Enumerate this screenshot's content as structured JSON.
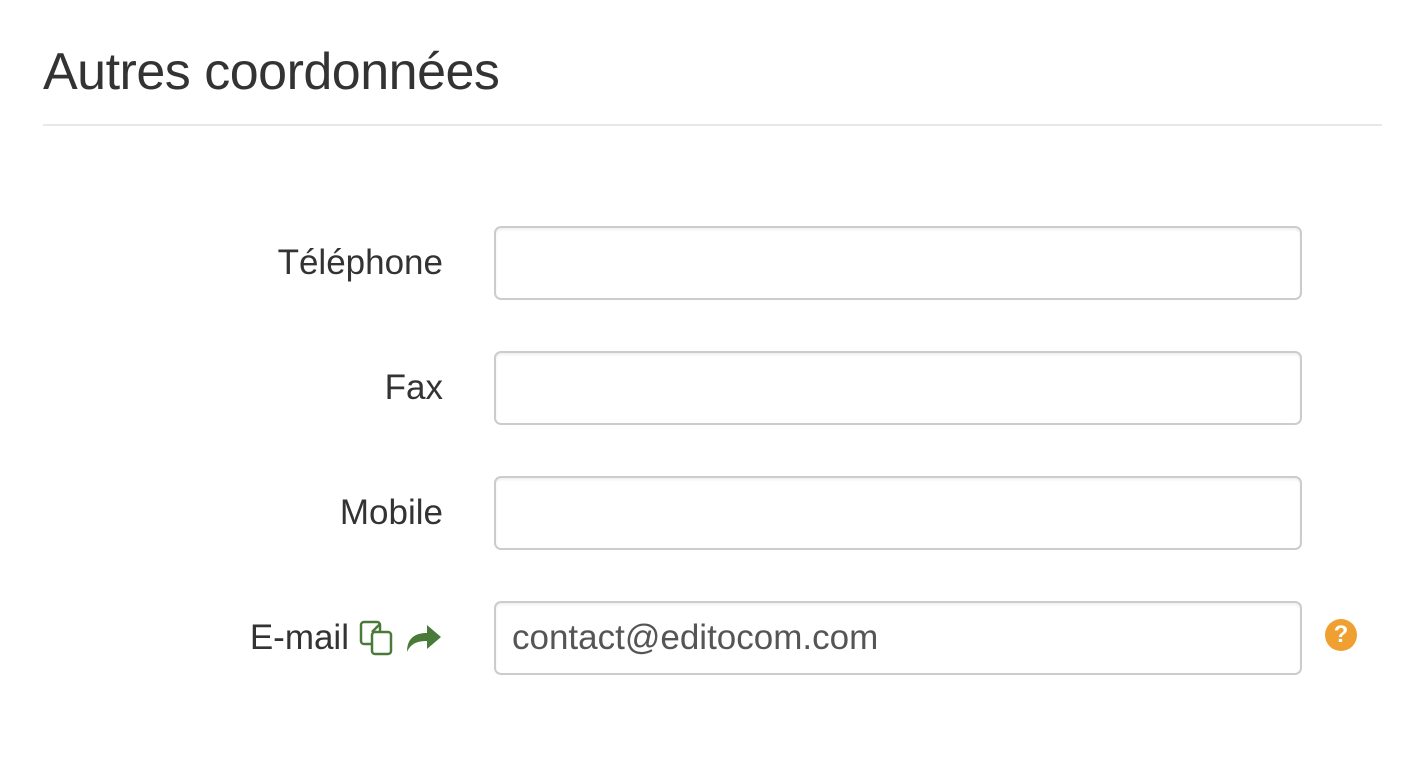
{
  "section": {
    "title": "Autres coordonnées"
  },
  "form": {
    "fields": [
      {
        "label": "Téléphone",
        "value": "",
        "placeholder": ""
      },
      {
        "label": "Fax",
        "value": "",
        "placeholder": ""
      },
      {
        "label": "Mobile",
        "value": "",
        "placeholder": ""
      },
      {
        "label": "E-mail",
        "value": "contact@editocom.com",
        "placeholder": ""
      }
    ],
    "email_icons": {
      "copy": "copy-icon",
      "forward": "forward-arrow-icon"
    },
    "help": {
      "icon": "question-circle-icon",
      "glyph": "?"
    }
  },
  "colors": {
    "text": "#333333",
    "input_border": "#cccccc",
    "divider": "#e8e8e8",
    "icon_green": "#4a7a3a",
    "help_orange": "#f0a030"
  }
}
